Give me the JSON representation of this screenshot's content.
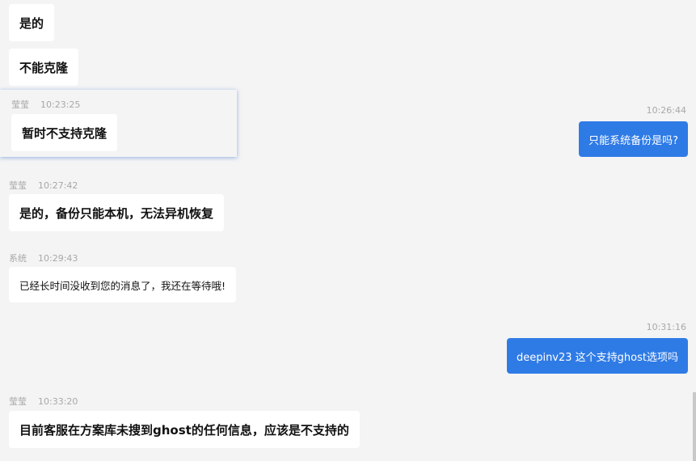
{
  "messages": [
    {
      "text": "是的"
    },
    {
      "text": "不能克隆"
    },
    {
      "sender": "莹莹",
      "time": "10:23:25",
      "text": "暂时不支持克隆"
    },
    {
      "time": "10:26:44",
      "text": "只能系统备份是吗?"
    },
    {
      "sender": "莹莹",
      "time": "10:27:42",
      "text": "是的，备份只能本机，无法异机恢复"
    },
    {
      "sender": "系统",
      "time": "10:29:43",
      "text": "已经长时间没收到您的消息了，我还在等待哦!"
    },
    {
      "time": "10:31:16",
      "text": "deepinv23 这个支持ghost选项吗"
    },
    {
      "sender": "莹莹",
      "time": "10:33:20",
      "text": "目前客服在方案库未搜到ghost的任何信息，应该是不支持的"
    }
  ],
  "colors": {
    "outgoing": "#2f7be6",
    "background": "#f4f4f4"
  }
}
